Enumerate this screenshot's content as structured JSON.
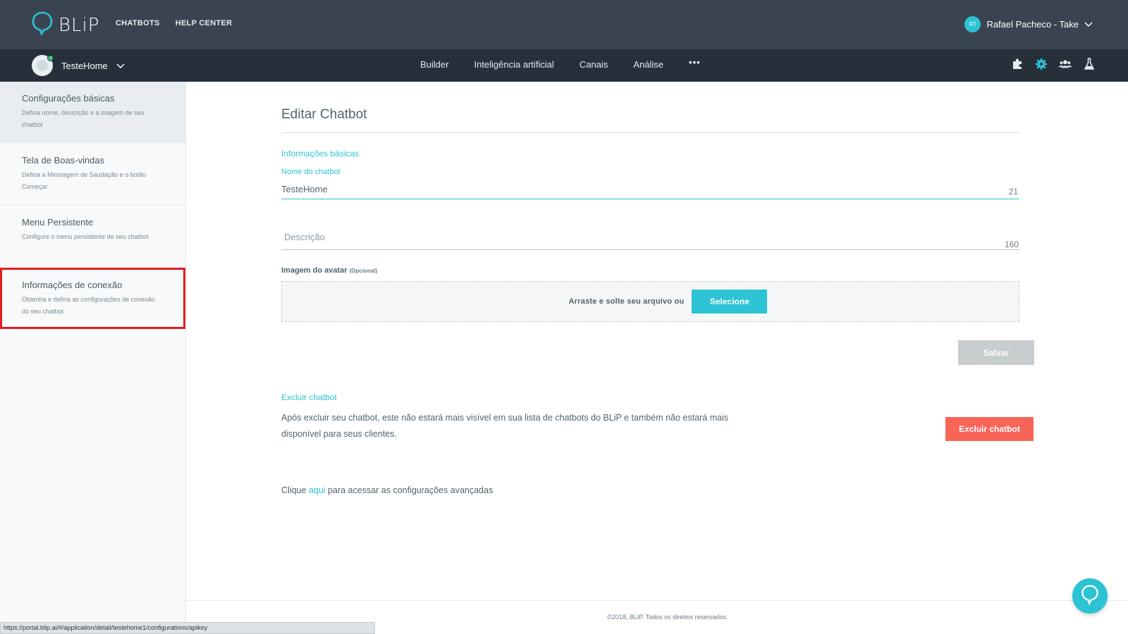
{
  "topbar": {
    "logo_text": "BLiP",
    "nav": [
      "CHATBOTS",
      "HELP CENTER"
    ],
    "user_initials": "RT",
    "user_name": "Rafael Pacheco - Take"
  },
  "subbar": {
    "bot_name": "TesteHome",
    "nav": [
      "Builder",
      "Inteligência artificial",
      "Canais",
      "Análise"
    ],
    "more": "•••",
    "tools": [
      "puzzle-icon",
      "gear-icon",
      "users-icon",
      "flask-icon"
    ]
  },
  "sidebar": {
    "items": [
      {
        "title": "Configurações básicas",
        "desc": "Defina nome, descrição e a imagem de seu chatbot"
      },
      {
        "title": "Tela de Boas-vindas",
        "desc": "Defina a Mensagem de Saudação e o botão Começar"
      },
      {
        "title": "Menu Persistente",
        "desc": "Configure o menu persistente de seu chatbot"
      },
      {
        "title": "Informações de conexão",
        "desc": "Obtenha e defina as configurações de conexão do seu chatbot"
      }
    ]
  },
  "main": {
    "title": "Editar Chatbot",
    "basic_info_label": "Informações básicas",
    "name_label": "Nome do chatbot",
    "name_value": "TesteHome",
    "name_counter": "21",
    "description_placeholder": "Descrição",
    "description_counter": "160",
    "avatar_label": "Imagem do avatar",
    "avatar_optional": "(Opcional)",
    "dropzone_text": "Arraste e solte seu arquivo ou",
    "select_button": "Selecione",
    "save_button": "Salvar",
    "delete_label": "Excluir chatbot",
    "delete_text": "Após excluir seu chatbot, este não estará mais visível em sua lista de chatbots do BLiP e também não estará mais disponível para seus clientes.",
    "delete_button": "Excluir chatbot",
    "advanced_prefix": "Clique",
    "advanced_link": "aqui",
    "advanced_suffix": "para acessar as configurações avançadas",
    "footer": "©2018, BLiP. Todos os direitos reservados."
  },
  "statusbar": {
    "url": "https://portal.blip.ai/#/application/detail/testehome1/configurations/apikey"
  },
  "colors": {
    "accent": "#2cc3d5",
    "danger": "#f76556",
    "topbar": "#3a4451",
    "subbar": "#26303b",
    "highlight": "#e51c23"
  }
}
